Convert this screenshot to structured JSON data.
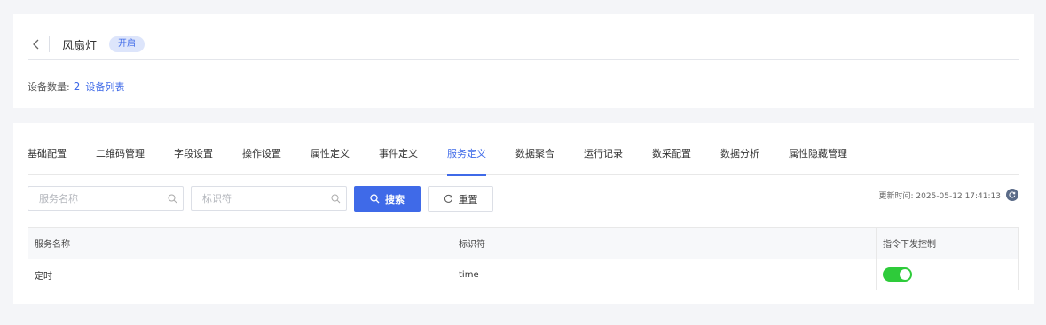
{
  "header": {
    "device_name": "风扇灯",
    "status": "开启",
    "device_count_label": "设备数量:",
    "device_count": "2",
    "device_list_link": "设备列表"
  },
  "tabs": [
    {
      "label": "基础配置",
      "active": false
    },
    {
      "label": "二维码管理",
      "active": false
    },
    {
      "label": "字段设置",
      "active": false
    },
    {
      "label": "操作设置",
      "active": false
    },
    {
      "label": "属性定义",
      "active": false
    },
    {
      "label": "事件定义",
      "active": false
    },
    {
      "label": "服务定义",
      "active": true
    },
    {
      "label": "数据聚合",
      "active": false
    },
    {
      "label": "运行记录",
      "active": false
    },
    {
      "label": "数采配置",
      "active": false
    },
    {
      "label": "数据分析",
      "active": false
    },
    {
      "label": "属性隐藏管理",
      "active": false
    }
  ],
  "search": {
    "service_name_placeholder": "服务名称",
    "identifier_placeholder": "标识符",
    "search_label": "搜索",
    "reset_label": "重置"
  },
  "update_time": "更新时间: 2025-05-12 17:41:13",
  "table": {
    "headers": [
      "服务名称",
      "标识符",
      "指令下发控制"
    ],
    "rows": [
      {
        "name": "定时",
        "identifier": "time",
        "control_enabled": true
      }
    ]
  },
  "colors": {
    "accent": "#3f6ae8",
    "switch_on": "#2ecb3a",
    "background": "#f4f5f8"
  }
}
